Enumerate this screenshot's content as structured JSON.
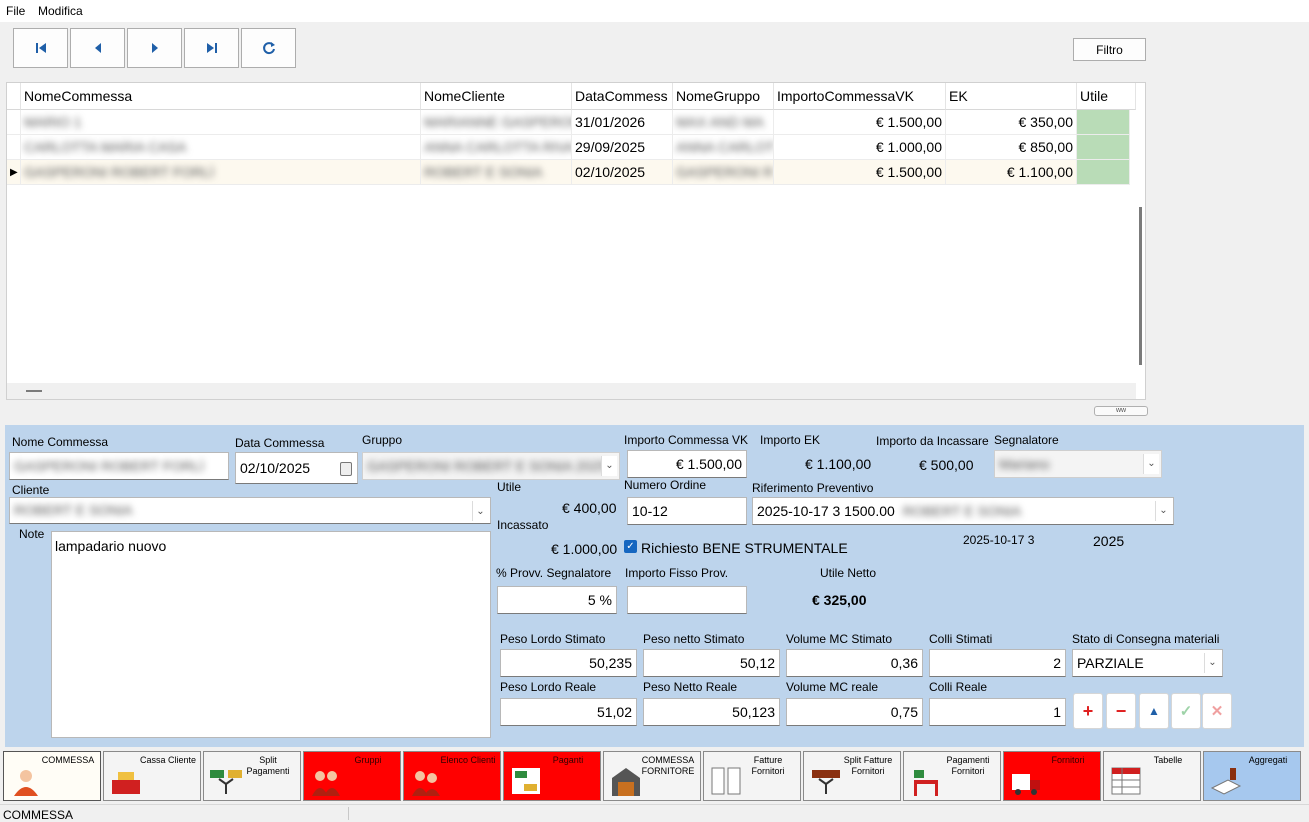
{
  "menu": [
    "File",
    "Modifica"
  ],
  "toolbar": {
    "filtro": "Filtro"
  },
  "grid": {
    "columns": [
      "NomeCommessa",
      "NomeCliente",
      "DataCommess",
      "NomeGruppo",
      "ImportoCommessaVK",
      "EK",
      "Utile"
    ],
    "rows": [
      {
        "nome": "MARIO 1",
        "cliente": "MARIANNE GASPERONI",
        "data": "31/01/2026",
        "gruppo": "MAX AND MA",
        "importo": "€ 1.500,00",
        "ek": "€ 350,00"
      },
      {
        "nome": "CARLOTTA MARIA CASA",
        "cliente": "ANNA CARLOTTA RIVA",
        "data": "29/09/2025",
        "gruppo": "ANNA CARLOT",
        "importo": "€ 1.000,00",
        "ek": "€ 850,00"
      },
      {
        "nome": "GASPERONI ROBERT FORLÌ",
        "cliente": "ROBERT E SONIA",
        "data": "02/10/2025",
        "gruppo": "GASPERONI R",
        "importo": "€ 1.500,00",
        "ek": "€ 1.100,00"
      }
    ]
  },
  "splitter_label": "ww",
  "form": {
    "nome_commessa_label": "Nome Commessa",
    "nome_commessa_value": "GASPERONI ROBERT FORLÌ",
    "data_commessa_label": "Data Commessa",
    "data_commessa_value": "02/10/2025",
    "gruppo_label": "Gruppo",
    "gruppo_value": "GASPERONI ROBERT E SONIA 2025",
    "importo_vk_label": "Importo Commessa VK",
    "importo_vk_value": "€ 1.500,00",
    "importo_ek_label": "Importo EK",
    "importo_ek_value": "€ 1.100,00",
    "importo_incassare_label": "Importo da Incassare",
    "importo_incassare_value": "€ 500,00",
    "segnalatore_label": "Segnalatore",
    "segnalatore_value": "Mariano",
    "cliente_label": "Cliente",
    "cliente_value": "ROBERT E SONIA",
    "utile_label": "Utile",
    "utile_value": "€ 400,00",
    "incassato_label": "Incassato",
    "incassato_value": "€ 1.000,00",
    "numero_ordine_label": "Numero Ordine",
    "numero_ordine_value": "10-12",
    "rif_preventivo_label": "Riferimento Preventivo",
    "rif_preventivo_value": "2025-10-17 3 1500.00",
    "rif_preventivo_blur": "ROBERT E SONIA",
    "rif_date": "2025-10-17 3",
    "rif_year": "2025",
    "note_label": "Note",
    "note_value": "lampadario nuovo",
    "bene_strumentale_label": "Richiesto BENE STRUMENTALE",
    "provv_label": "% Provv. Segnalatore",
    "provv_value": "5 %",
    "fisso_label": "Importo Fisso Prov.",
    "fisso_value": "",
    "utile_netto_label": "Utile Netto",
    "utile_netto_value": "€ 325,00",
    "peso_lordo_stimato_label": "Peso Lordo Stimato",
    "peso_lordo_stimato_value": "50,235",
    "peso_netto_stimato_label": "Peso netto Stimato",
    "peso_netto_stimato_value": "50,12",
    "volume_stimato_label": "Volume MC Stimato",
    "volume_stimato_value": "0,36",
    "colli_stimati_label": "Colli Stimati",
    "colli_stimati_value": "2",
    "stato_label": "Stato di Consegna materiali",
    "stato_value": "PARZIALE",
    "peso_lordo_reale_label": "Peso Lordo Reale",
    "peso_lordo_reale_value": "51,02",
    "peso_netto_reale_label": "Peso Netto Reale",
    "peso_netto_reale_value": "50,123",
    "volume_reale_label": "Volume MC reale",
    "volume_reale_value": "0,75",
    "colli_reale_label": "Colli Reale",
    "colli_reale_value": "1"
  },
  "tabs": [
    {
      "label": "COMMESSA",
      "icon": "person-icon",
      "state": "active"
    },
    {
      "label": "Cassa Cliente",
      "icon": "cash-register-icon",
      "state": "normal"
    },
    {
      "label": "Split Pagamenti",
      "icon": "split-payment-icon",
      "state": "normal"
    },
    {
      "label": "Gruppi",
      "icon": "group-icon",
      "state": "red"
    },
    {
      "label": "Elenco Clienti",
      "icon": "clients-icon",
      "state": "red"
    },
    {
      "label": "Paganti",
      "icon": "payers-icon",
      "state": "red"
    },
    {
      "label": "COMMESSA FORNITORE",
      "icon": "warehouse-icon",
      "state": "normal"
    },
    {
      "label": "Fatture Fornitori",
      "icon": "invoice-icon",
      "state": "normal"
    },
    {
      "label": "Split Fatture Fornitori",
      "icon": "split-invoice-icon",
      "state": "normal"
    },
    {
      "label": "Pagamenti Fornitori",
      "icon": "supplier-payment-icon",
      "state": "normal"
    },
    {
      "label": "Fornitori",
      "icon": "truck-icon",
      "state": "red"
    },
    {
      "label": "Tabelle",
      "icon": "table-icon",
      "state": "normal"
    },
    {
      "label": "Aggregati",
      "icon": "aggregate-icon",
      "state": "blue"
    }
  ],
  "status": {
    "text": "COMMESSA"
  },
  "colors": {
    "form_bg": "#bdd4ec",
    "tab_red": "#ff0000",
    "tab_blue": "#a6c8ee",
    "utile_green": "#b9dcb7",
    "nav_blue": "#1f5fa8"
  }
}
